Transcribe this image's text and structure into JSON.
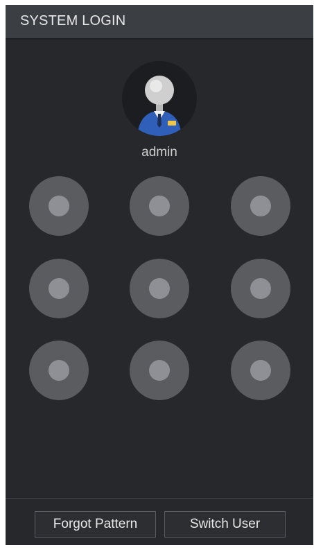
{
  "dialog": {
    "title": "SYSTEM LOGIN"
  },
  "user": {
    "name": "admin",
    "avatar_icon": "user-avatar-icon"
  },
  "pattern_grid": {
    "rows": 3,
    "cols": 3
  },
  "footer": {
    "forgot_label": "Forgot Pattern",
    "switch_label": "Switch User"
  },
  "colors": {
    "dialog_bg": "#26282b",
    "title_bar_bg": "#3b3e43",
    "node_outer": "#5b5c60",
    "node_inner": "#8f9095",
    "avatar_accent": "#2f5fb8"
  }
}
